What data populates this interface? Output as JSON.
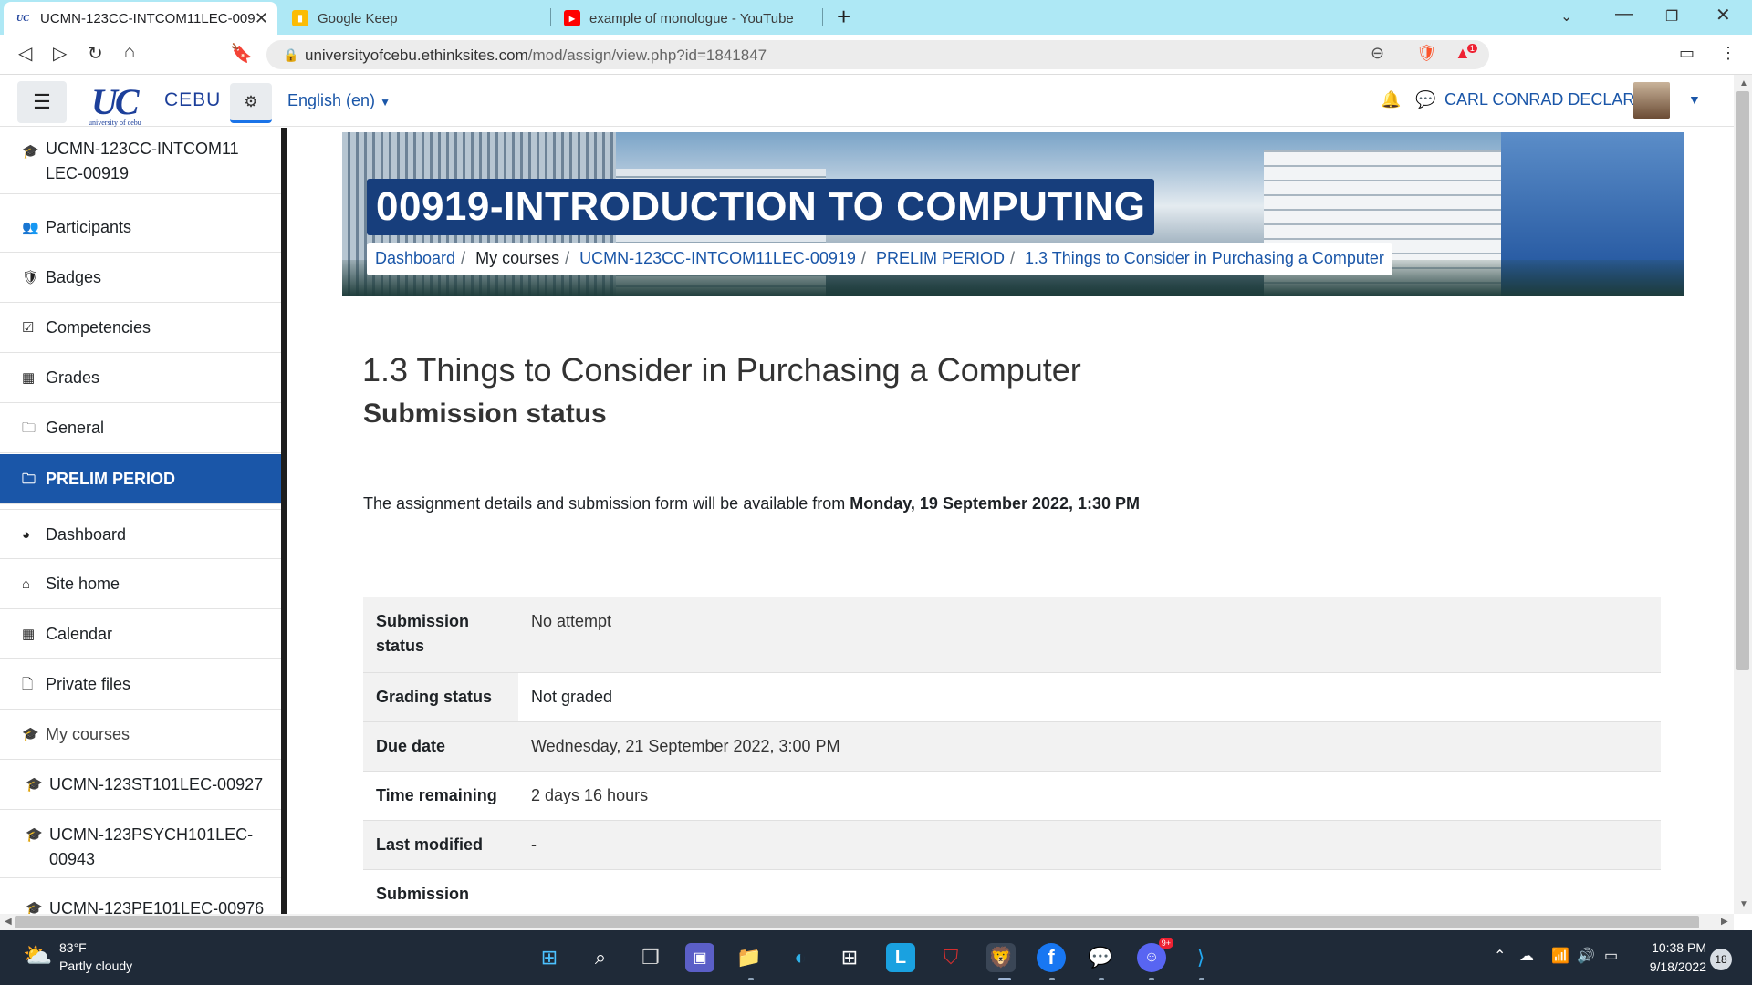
{
  "browser": {
    "tabs": [
      {
        "title": "UCMN-123CC-INTCOM11LEC-009",
        "favicon": "UC",
        "active": true
      },
      {
        "title": "Google Keep",
        "favicon": "keep-icon",
        "active": false
      },
      {
        "title": "example of monologue - YouTube",
        "favicon": "youtube-icon",
        "active": false
      }
    ],
    "url_host": "universityofcebu.ethinksites.com",
    "url_path": "/mod/assign/view.php?id=1841847",
    "brave_badge": "1"
  },
  "header": {
    "logo_text": "UC",
    "logo_subtext": "university of cebu",
    "logo_campus": "CEBU",
    "language": "English (en)",
    "user_name": "CARL CONRAD DECLARO"
  },
  "sidebar": {
    "items": [
      {
        "label": "UCMN-123CC-INTCOM11LEC-00919",
        "icon": "graduation-cap-icon",
        "glyph": "🎓"
      },
      {
        "label": "Participants",
        "icon": "users-icon",
        "glyph": "👥"
      },
      {
        "label": "Badges",
        "icon": "shield-icon",
        "glyph": "🛡"
      },
      {
        "label": "Competencies",
        "icon": "check-square-icon",
        "glyph": "☑"
      },
      {
        "label": "Grades",
        "icon": "table-icon",
        "glyph": "▦"
      },
      {
        "label": "General",
        "icon": "folder-icon",
        "glyph": "🗀"
      },
      {
        "label": "PRELIM PERIOD",
        "icon": "folder-icon",
        "glyph": "🗀",
        "active": true
      },
      {
        "label": "Dashboard",
        "icon": "dashboard-icon",
        "glyph": "◕"
      },
      {
        "label": "Site home",
        "icon": "home-icon",
        "glyph": "⌂"
      },
      {
        "label": "Calendar",
        "icon": "calendar-icon",
        "glyph": "▦"
      },
      {
        "label": "Private files",
        "icon": "file-icon",
        "glyph": "🗋"
      },
      {
        "label": "My courses",
        "icon": "graduation-cap-icon",
        "glyph": "🎓"
      },
      {
        "label": "UCMN-123ST101LEC-00927",
        "icon": "graduation-cap-icon",
        "glyph": "🎓"
      },
      {
        "label": "UCMN-123PSYCH101LEC-00943",
        "icon": "graduation-cap-icon",
        "glyph": "🎓"
      },
      {
        "label": "UCMN-123PE101LEC-00976",
        "icon": "graduation-cap-icon",
        "glyph": "🎓"
      }
    ]
  },
  "course": {
    "title": "00919-INTRODUCTION TO COMPUTING",
    "breadcrumb": [
      "Dashboard",
      "My courses",
      "UCMN-123CC-INTCOM11LEC-00919",
      "PRELIM PERIOD",
      "1.3 Things to Consider in Purchasing a Computer"
    ]
  },
  "main": {
    "title": "1.3 Things to Consider in Purchasing a Computer",
    "subtitle": "Submission status",
    "availability_prefix": "The assignment details and submission form will be available from ",
    "availability_date": "Monday, 19 September 2022, 1:30 PM",
    "status_rows": [
      {
        "label": "Submission status",
        "value": "No attempt"
      },
      {
        "label": "Grading status",
        "value": "Not graded"
      },
      {
        "label": "Due date",
        "value": "Wednesday, 21 September 2022, 3:00 PM"
      },
      {
        "label": "Time remaining",
        "value": "2 days 16 hours"
      },
      {
        "label": "Last modified",
        "value": "-"
      },
      {
        "label": "Submission",
        "value": ""
      }
    ]
  },
  "taskbar": {
    "weather_temp": "83°F",
    "weather_desc": "Partly cloudy",
    "time": "10:38 PM",
    "date": "9/18/2022",
    "notification_count": "18",
    "discord_badge": "9+"
  },
  "colors": {
    "accent": "#1a56a8",
    "title_bg": "#173e7c",
    "tabbar": "#aee8f5",
    "taskbar": "#1f2a38"
  }
}
